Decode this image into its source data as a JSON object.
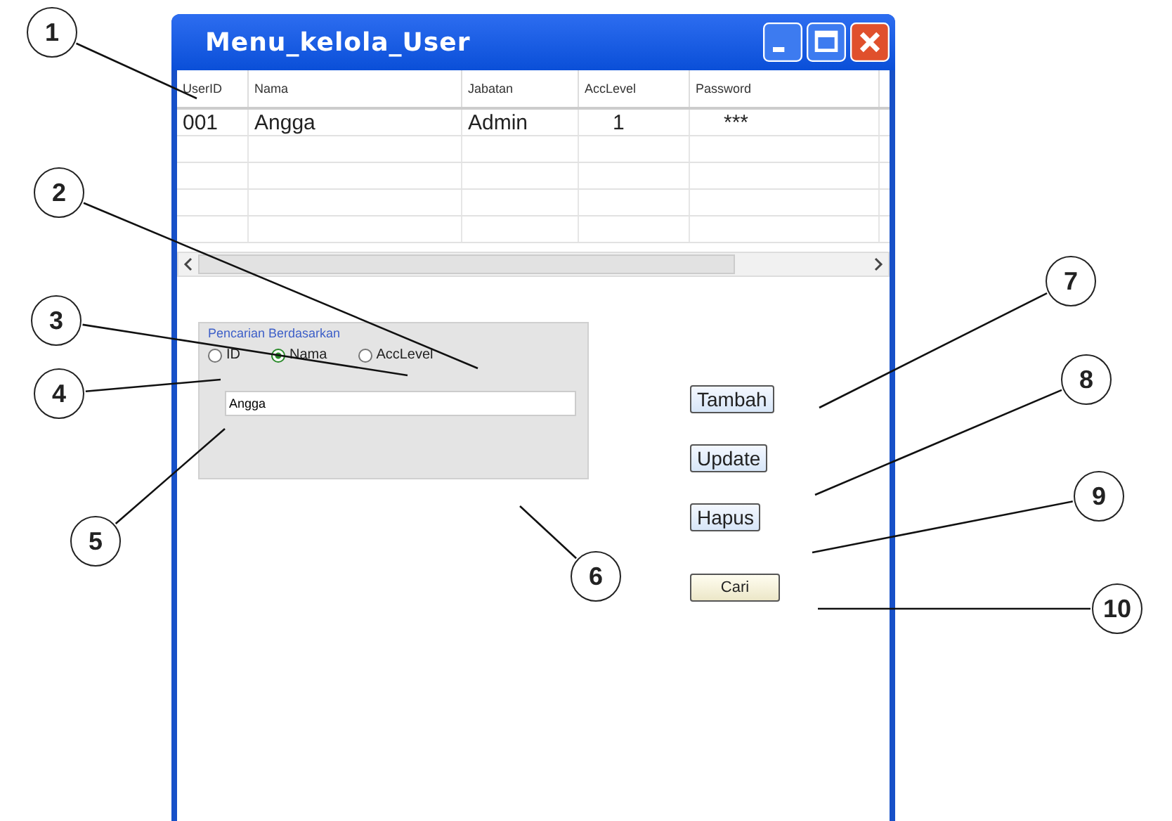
{
  "window": {
    "title": "Menu_kelola_User"
  },
  "table": {
    "columns": [
      "UserID",
      "Nama",
      "Jabatan",
      "AccLevel",
      "Password"
    ],
    "rows": [
      [
        "001",
        "Angga",
        "Admin",
        "1",
        "***"
      ]
    ]
  },
  "search": {
    "group_label": "Pencarian Berdasarkan",
    "options": [
      {
        "label": "ID",
        "selected": false
      },
      {
        "label": "Nama",
        "selected": true
      },
      {
        "label": "AccLevel",
        "selected": false
      }
    ],
    "value": "Angga"
  },
  "buttons": [
    {
      "label": "Tambah",
      "kind": "action"
    },
    {
      "label": "Update",
      "kind": "action"
    },
    {
      "label": "Hapus",
      "kind": "action"
    },
    {
      "label": "Cari",
      "kind": "search"
    }
  ],
  "callouts": [
    "1",
    "2",
    "3",
    "4",
    "5",
    "6",
    "7",
    "8",
    "9",
    "10"
  ]
}
